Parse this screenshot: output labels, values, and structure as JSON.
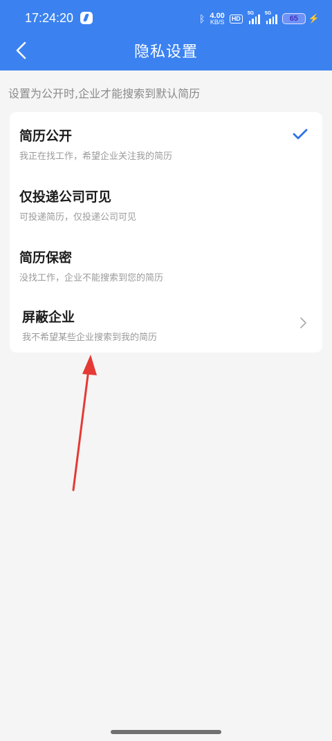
{
  "status_bar": {
    "time": "17:24:20",
    "net_speed": "4.00",
    "net_unit": "KB/S",
    "hd_label": "HD",
    "sim1_label": "5G",
    "sim2_label": "5G",
    "battery": "65"
  },
  "header": {
    "title": "隐私设置"
  },
  "hint": "设置为公开时,企业才能搜索到默认简历",
  "options": [
    {
      "title": "简历公开",
      "subtitle": "我正在找工作，希望企业关注我的简历",
      "selected": true
    },
    {
      "title": "仅投递公司可见",
      "subtitle": "可投递简历，仅投递公司可见",
      "selected": false
    },
    {
      "title": "简历保密",
      "subtitle": "没找工作，企业不能搜索到您的简历",
      "selected": false
    },
    {
      "title": "屏蔽企业",
      "subtitle": "我不希望某些企业搜索到我的简历",
      "selected": false
    }
  ],
  "colors": {
    "header": "#3b82f0",
    "accent": "#2f72e4",
    "annotation_arrow": "#e53935"
  }
}
